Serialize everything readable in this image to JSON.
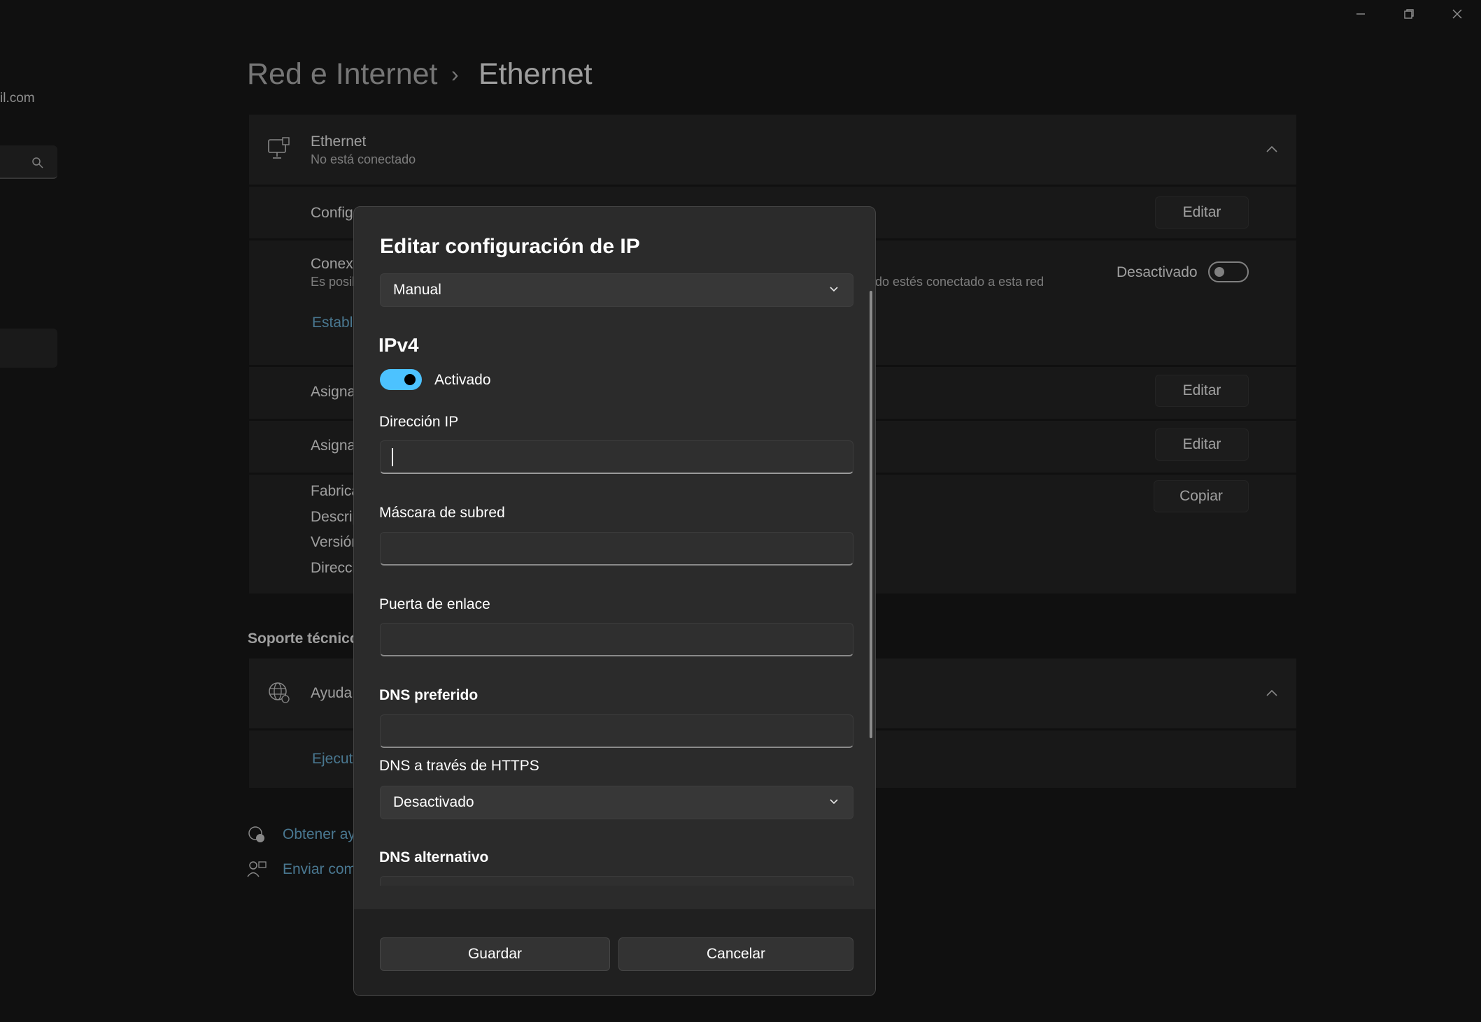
{
  "window": {
    "controls": {
      "minimize": "minimize",
      "restore": "restore",
      "close": "close"
    }
  },
  "sidebar": {
    "email_fragment": "il.com"
  },
  "breadcrumb": {
    "parent": "Red e Internet",
    "separator": "›",
    "current": "Ethernet"
  },
  "ethernet_card": {
    "title": "Ethernet",
    "status": "No está conectado"
  },
  "rows": {
    "config_label": "Config",
    "edit1": "Editar",
    "metered_label": "Conexi",
    "metered_sub_left": "Es posib",
    "metered_sub_right": "do estés conectado a esta red",
    "metered_state": "Desactivado",
    "link_left": "Estable",
    "assign1_label": "Asigna",
    "edit2": "Editar",
    "assign2_label": "Asigna",
    "edit3": "Editar",
    "props": [
      "Fabrica",
      "Descrip",
      "Versión",
      "Direcci"
    ],
    "copy": "Copiar"
  },
  "support": {
    "heading": "Soporte técnico",
    "help_label": "Ayuda",
    "run_link": "Ejecuta",
    "get_help": "Obtener ay",
    "send_feedback": "Enviar com"
  },
  "dialog": {
    "title": "Editar configuración de IP",
    "mode_value": "Manual",
    "ipv4_heading": "IPv4",
    "ipv4_toggle_label": "Activado",
    "ip_label": "Dirección IP",
    "ip_value": "",
    "mask_label": "Máscara de subred",
    "mask_value": "",
    "gateway_label": "Puerta de enlace",
    "gateway_value": "",
    "dns_pref_label": "DNS preferido",
    "dns_pref_value": "",
    "doh_label": "DNS a través de HTTPS",
    "doh_value": "Desactivado",
    "dns_alt_label": "DNS alternativo",
    "save": "Guardar",
    "cancel": "Cancelar"
  },
  "colors": {
    "accent": "#4cc2ff",
    "link": "#77c0e8",
    "background": "#1a1a1a",
    "card": "#272727"
  }
}
